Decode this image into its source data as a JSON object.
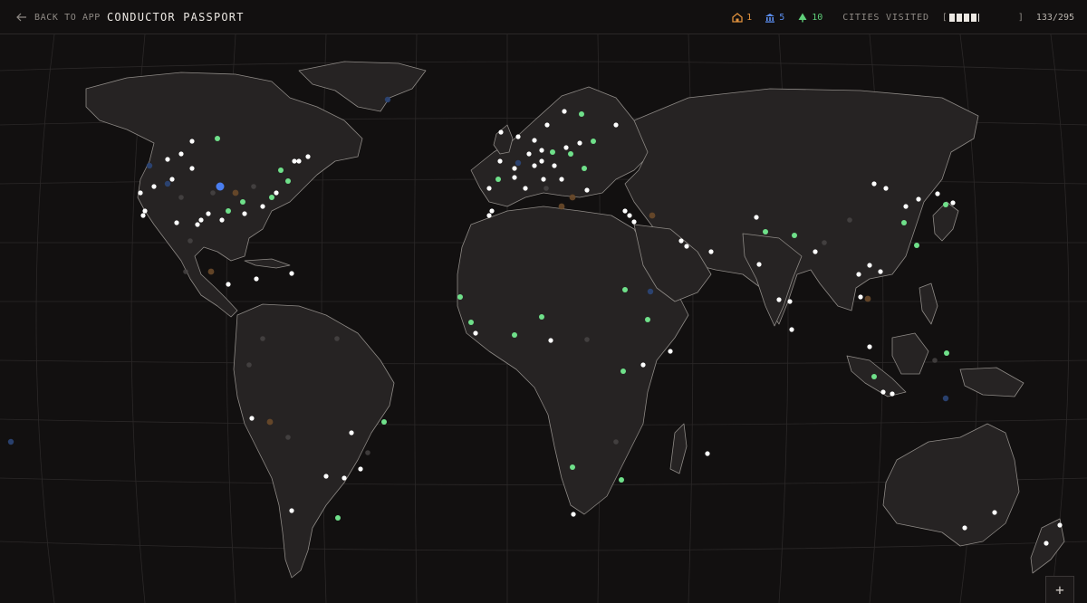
{
  "header": {
    "back_label": "BACK TO APP",
    "title": "CONDUCTOR PASSPORT",
    "stats": [
      {
        "icon": "house-icon",
        "value": "1",
        "color": "#e0913d"
      },
      {
        "icon": "bank-icon",
        "value": "5",
        "color": "#5b8ef0"
      },
      {
        "icon": "tree-icon",
        "value": "10",
        "color": "#5fd07a"
      }
    ],
    "cities_label": "CITIES VISITED",
    "cities_visited": 133,
    "cities_total": 295,
    "cities_count_text": "133/295",
    "bar_open": "[",
    "bar_close": "]"
  },
  "map": {
    "colors": {
      "land": "#262323",
      "border": "#8e8a86",
      "graticule": "#2b2828",
      "visited": "#ffffff",
      "visited_green": "#6fe08a",
      "dim": "#4a4646",
      "dim_green": "#2f5a3a",
      "dim_blue": "#2c4678",
      "dim_orange": "#6b4a2a"
    },
    "zoom_in_label": "+"
  }
}
